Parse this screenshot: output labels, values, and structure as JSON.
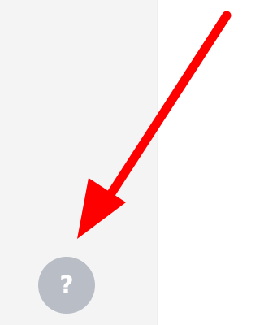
{
  "help_button": {
    "glyph": "?",
    "icon": "question-mark-icon",
    "color": "#b9bec6"
  },
  "annotation": {
    "icon": "arrow-icon",
    "color": "#ff0000"
  },
  "colors": {
    "sidebar_background": "#f4f4f5",
    "main_background": "#ffffff"
  }
}
